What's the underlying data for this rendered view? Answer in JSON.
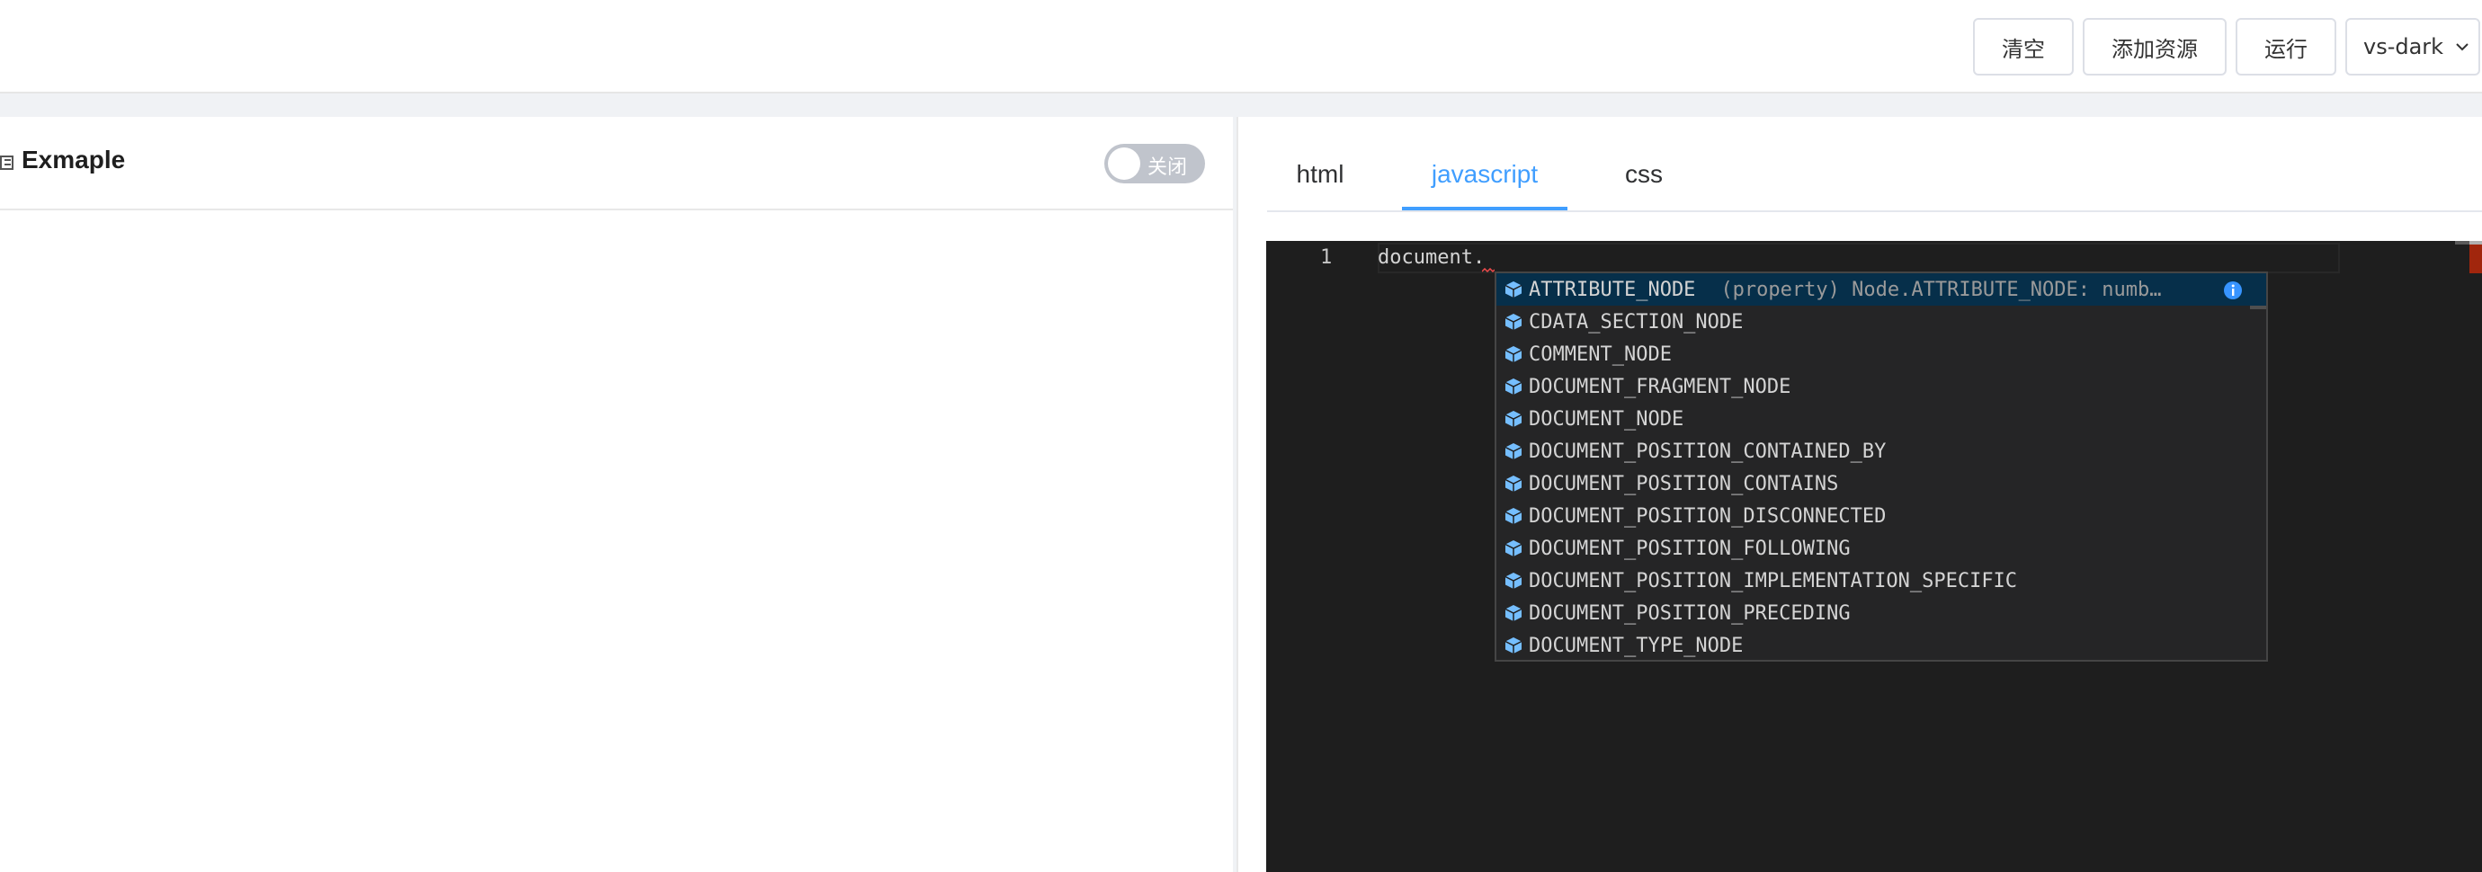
{
  "toolbar": {
    "clear_label": "清空",
    "add_resource_label": "添加资源",
    "run_label": "运行",
    "theme_value": "vs-dark"
  },
  "left": {
    "title": "Exmaple",
    "toggle_label": "关闭"
  },
  "tabs": [
    {
      "label": "html",
      "active": false
    },
    {
      "label": "javascript",
      "active": true
    },
    {
      "label": "css",
      "active": false
    }
  ],
  "editor": {
    "line_number": "1",
    "code": "document.",
    "theme": "vs-dark"
  },
  "suggestions": {
    "selected_detail": "(property) Node.ATTRIBUTE_NODE: numb…",
    "items": [
      "ATTRIBUTE_NODE",
      "CDATA_SECTION_NODE",
      "COMMENT_NODE",
      "DOCUMENT_FRAGMENT_NODE",
      "DOCUMENT_NODE",
      "DOCUMENT_POSITION_CONTAINED_BY",
      "DOCUMENT_POSITION_CONTAINS",
      "DOCUMENT_POSITION_DISCONNECTED",
      "DOCUMENT_POSITION_FOLLOWING",
      "DOCUMENT_POSITION_IMPLEMENTATION_SPECIFIC",
      "DOCUMENT_POSITION_PRECEDING",
      "DOCUMENT_TYPE_NODE"
    ]
  },
  "colors": {
    "accent": "#409eff",
    "editor_bg": "#1e1e1e",
    "suggest_bg": "#252526",
    "suggest_selected": "#062f4a"
  }
}
